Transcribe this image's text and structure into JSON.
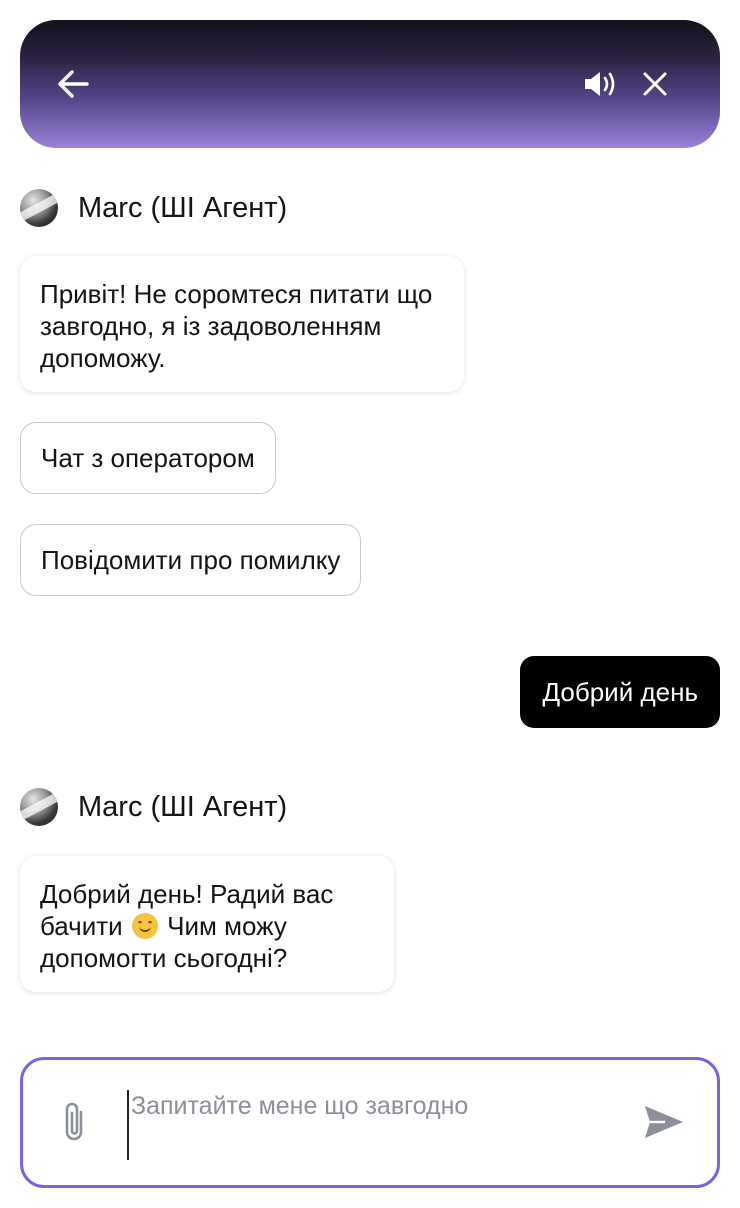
{
  "header": {
    "back_icon": "arrow-left-icon",
    "sound_icon": "speaker-icon",
    "close_icon": "close-icon",
    "gradient_top": "#120f1c",
    "gradient_bottom": "#9b82d9"
  },
  "agent": {
    "name": "Marc (ШІ Агент)",
    "avatar_icon": "agent-avatar-icon"
  },
  "messages": {
    "greeting": "Привіт! Не соромтеся питати що завгодно, я із задоволенням допоможу.",
    "quick_replies": [
      "Чат з оператором",
      "Повідомити про помилку"
    ],
    "user_message": "Добрий день",
    "reply_part1": "Добрий день! Радий вас бачити",
    "reply_emoji": "smiling-face-emoji",
    "reply_part2": "Чим можу допомогти сьогодні?"
  },
  "composer": {
    "placeholder": "Запитайте мене що завгодно",
    "value": "",
    "attach_icon": "paperclip-icon",
    "send_icon": "send-icon",
    "border_color": "#7266e6"
  }
}
